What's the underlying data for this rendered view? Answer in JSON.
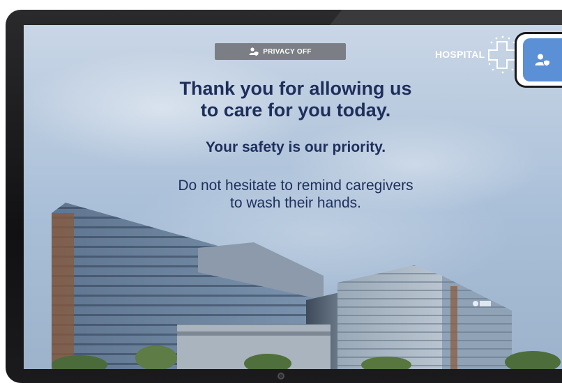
{
  "privacy_bar": {
    "label": "PRIVACY OFF",
    "icon": "user-shield-icon"
  },
  "logo": {
    "name": "HOSPITAL",
    "icon": "cross-stars-icon"
  },
  "privacy_toggle": {
    "icon": "user-shield-icon",
    "accent": "#5b8fd6"
  },
  "message": {
    "line1": "Thank you for allowing us",
    "line2": "to care for you today.",
    "subtitle": "Your safety is our priority.",
    "reminder_line1": "Do not hesitate to remind caregivers",
    "reminder_line2": "to wash their hands."
  },
  "colors": {
    "text": "#1e2f5c",
    "bezel": "#141416",
    "privacy_bar": "#7b7f85"
  }
}
